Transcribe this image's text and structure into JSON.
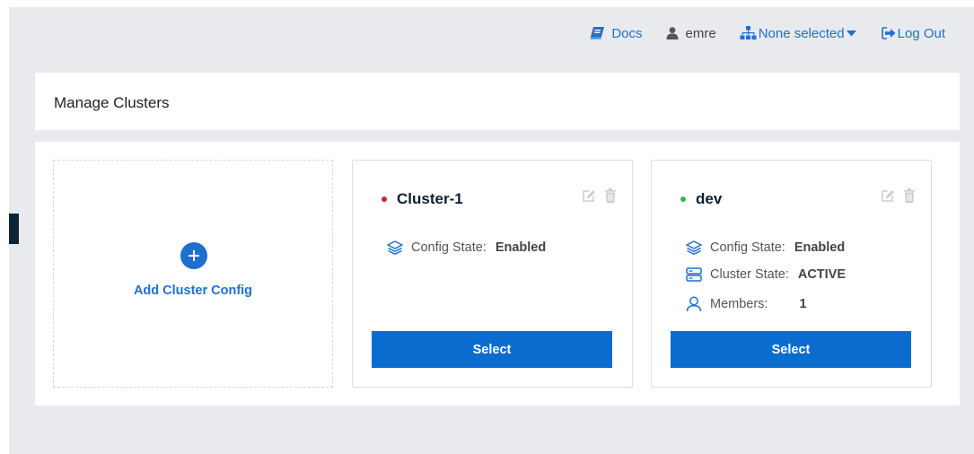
{
  "colors": {
    "accent": "#1f6fd1",
    "button": "#0a6ccf",
    "status_red": "#c9252b",
    "status_green": "#2db84d",
    "background": "#e9eaed"
  },
  "nav": {
    "docs": {
      "label": "Docs",
      "icon": "book-icon"
    },
    "user": {
      "label": "emre",
      "icon": "user-icon"
    },
    "cluster_selector": {
      "label": "None selected",
      "icon": "sitemap-icon"
    },
    "logout": {
      "label": "Log Out",
      "icon": "sign-out-icon"
    }
  },
  "page": {
    "title": "Manage Clusters"
  },
  "add_card": {
    "label": "Add Cluster Config",
    "icon": "plus-circle-icon"
  },
  "clusters": [
    {
      "name": "Cluster-1",
      "status_color": "#c9252b",
      "config_state_label": "Config State:",
      "config_state_value": "Enabled",
      "select_label": "Select"
    },
    {
      "name": "dev",
      "status_color": "#2db84d",
      "config_state_label": "Config State:",
      "config_state_value": "Enabled",
      "cluster_state_label": "Cluster State:",
      "cluster_state_value": "ACTIVE",
      "members_label": "Members:",
      "members_value": "1",
      "select_label": "Select"
    }
  ]
}
